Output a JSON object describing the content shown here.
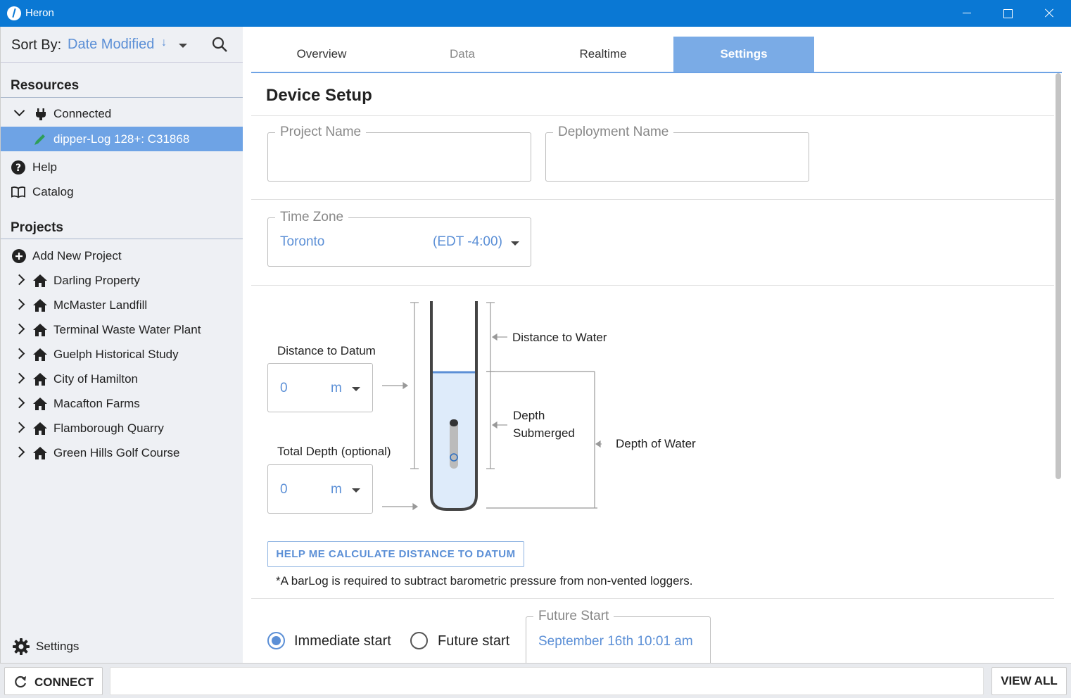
{
  "window": {
    "title": "Heron"
  },
  "sidebar": {
    "sort_label": "Sort By:",
    "sort_value": "Date Modified",
    "sort_direction": "↓",
    "resources_heading": "Resources",
    "connected_label": "Connected",
    "device_label": "dipper-Log 128+: C31868",
    "help_label": "Help",
    "catalog_label": "Catalog",
    "projects_heading": "Projects",
    "add_project_label": "Add New Project",
    "projects": [
      "Darling Property",
      "McMaster Landfill",
      "Terminal Waste Water Plant",
      "Guelph Historical Study",
      "City of Hamilton",
      "Macafton Farms",
      "Flamborough Quarry",
      "Green Hills Golf Course"
    ],
    "settings_label": "Settings"
  },
  "tabs": {
    "overview": "Overview",
    "data": "Data",
    "realtime": "Realtime",
    "settings": "Settings"
  },
  "setup": {
    "title": "Device Setup",
    "project_name_label": "Project Name",
    "project_name_value": "",
    "deployment_name_label": "Deployment Name",
    "deployment_name_value": "",
    "timezone_label": "Time Zone",
    "timezone_city": "Toronto",
    "timezone_offset": "(EDT -4:00)",
    "datum_label": "Distance to Datum",
    "datum_value": "0",
    "datum_unit": "m",
    "total_depth_label": "Total Depth (optional)",
    "total_depth_value": "0",
    "total_depth_unit": "m",
    "diagram": {
      "distance_to_water": "Distance to Water",
      "depth_submerged_1": "Depth",
      "depth_submerged_2": "Submerged",
      "depth_of_water": "Depth of Water"
    },
    "help_button": "HELP ME CALCULATE DISTANCE TO DATUM",
    "note": "*A barLog is required to subtract barometric pressure from non-vented loggers.",
    "immediate_start": "Immediate start",
    "future_start": "Future start",
    "future_start_label": "Future Start",
    "future_start_value": "September 16th 10:01 am"
  },
  "bottombar": {
    "connect": "CONNECT",
    "view_all": "VIEW ALL"
  },
  "colors": {
    "accent": "#5b8fd6",
    "titlebar": "#0a78d4",
    "selected": "#6ea3e5"
  }
}
